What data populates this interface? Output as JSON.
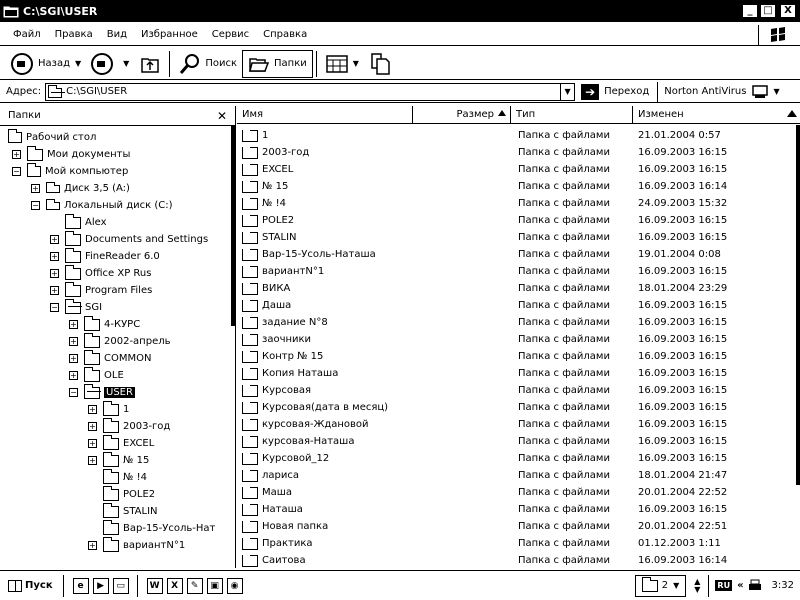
{
  "window": {
    "title": "C:\\SGI\\USER",
    "min_glyph": "_",
    "max_glyph": "□",
    "close_glyph": "X"
  },
  "menu": [
    "Файл",
    "Правка",
    "Вид",
    "Избранное",
    "Сервис",
    "Справка"
  ],
  "toolbar": {
    "back_label": "Назад",
    "search_label": "Поиск",
    "folders_label": "Папки"
  },
  "address": {
    "label": "Адрес:",
    "value": "C:\\SGI\\USER",
    "go_label": "Переход",
    "norton_label": "Norton AntiVirus"
  },
  "folders_panel": {
    "title": "Папки",
    "close_glyph": "✕",
    "tree": [
      {
        "label": "Рабочий стол",
        "level": 0,
        "expander": "none",
        "icon": "desktop"
      },
      {
        "label": "Мои документы",
        "level": 1,
        "expander": "+",
        "icon": "folder"
      },
      {
        "label": "Мой компьютер",
        "level": 1,
        "expander": "−",
        "icon": "computer"
      },
      {
        "label": "Диск 3,5 (A:)",
        "level": 2,
        "expander": "+",
        "icon": "floppy"
      },
      {
        "label": "Локальный диск (C:)",
        "level": 2,
        "expander": "−",
        "icon": "drive"
      },
      {
        "label": "Alex",
        "level": 3,
        "expander": "none",
        "icon": "folder"
      },
      {
        "label": "Documents and Settings",
        "level": 3,
        "expander": "+",
        "icon": "folder"
      },
      {
        "label": "FineReader 6.0",
        "level": 3,
        "expander": "+",
        "icon": "folder"
      },
      {
        "label": "Office XP Rus",
        "level": 3,
        "expander": "+",
        "icon": "folder"
      },
      {
        "label": "Program Files",
        "level": 3,
        "expander": "+",
        "icon": "folder"
      },
      {
        "label": "SGI",
        "level": 3,
        "expander": "−",
        "icon": "folder-open"
      },
      {
        "label": "4-КУРС",
        "level": 4,
        "expander": "+",
        "icon": "folder"
      },
      {
        "label": "2002-апрель",
        "level": 4,
        "expander": "+",
        "icon": "folder"
      },
      {
        "label": "COMMON",
        "level": 4,
        "expander": "+",
        "icon": "folder"
      },
      {
        "label": "OLE",
        "level": 4,
        "expander": "+",
        "icon": "folder"
      },
      {
        "label": "USER",
        "level": 4,
        "expander": "−",
        "icon": "folder-open",
        "selected": true
      },
      {
        "label": "1",
        "level": 5,
        "expander": "+",
        "icon": "folder"
      },
      {
        "label": "2003-год",
        "level": 5,
        "expander": "+",
        "icon": "folder"
      },
      {
        "label": "EXCEL",
        "level": 5,
        "expander": "+",
        "icon": "folder"
      },
      {
        "label": "№ 15",
        "level": 5,
        "expander": "+",
        "icon": "folder"
      },
      {
        "label": "№ !4",
        "level": 5,
        "expander": "none",
        "icon": "folder"
      },
      {
        "label": "POLE2",
        "level": 5,
        "expander": "none",
        "icon": "folder"
      },
      {
        "label": "STALIN",
        "level": 5,
        "expander": "none",
        "icon": "folder"
      },
      {
        "label": "Вар-15-Усоль-Нат",
        "level": 5,
        "expander": "none",
        "icon": "folder"
      },
      {
        "label": "вариантN°1",
        "level": 5,
        "expander": "+",
        "icon": "folder"
      }
    ]
  },
  "file_list": {
    "columns": {
      "name": "Имя",
      "size": "Размер",
      "type": "Тип",
      "modified": "Изменен"
    },
    "rows": [
      {
        "name": "1",
        "type": "Папка с файлами",
        "modified": "21.01.2004 0:57"
      },
      {
        "name": "2003-год",
        "type": "Папка с файлами",
        "modified": "16.09.2003 16:15"
      },
      {
        "name": "EXCEL",
        "type": "Папка с файлами",
        "modified": "16.09.2003 16:15"
      },
      {
        "name": "№ 15",
        "type": "Папка с файлами",
        "modified": "16.09.2003 16:14"
      },
      {
        "name": "№ !4",
        "type": "Папка с файлами",
        "modified": "24.09.2003 15:32"
      },
      {
        "name": "POLE2",
        "type": "Папка с файлами",
        "modified": "16.09.2003 16:15"
      },
      {
        "name": "STALIN",
        "type": "Папка с файлами",
        "modified": "16.09.2003 16:15"
      },
      {
        "name": "Вар-15-Усоль-Наташа",
        "type": "Папка с файлами",
        "modified": "19.01.2004 0:08"
      },
      {
        "name": "вариантN°1",
        "type": "Папка с файлами",
        "modified": "16.09.2003 16:15"
      },
      {
        "name": "ВИКА",
        "type": "Папка с файлами",
        "modified": "18.01.2004 23:29"
      },
      {
        "name": "Даша",
        "type": "Папка с файлами",
        "modified": "16.09.2003 16:15"
      },
      {
        "name": "задание N°8",
        "type": "Папка с файлами",
        "modified": "16.09.2003 16:15"
      },
      {
        "name": "заочники",
        "type": "Папка с файлами",
        "modified": "16.09.2003 16:15"
      },
      {
        "name": "Контр № 15",
        "type": "Папка с файлами",
        "modified": "16.09.2003 16:15"
      },
      {
        "name": "Копия Наташа",
        "type": "Папка с файлами",
        "modified": "16.09.2003 16:15"
      },
      {
        "name": "Курсовая",
        "type": "Папка с файлами",
        "modified": "16.09.2003 16:15"
      },
      {
        "name": "Курсовая(дата в месяц)",
        "type": "Папка с файлами",
        "modified": "16.09.2003 16:15"
      },
      {
        "name": "курсовая-Ждановой",
        "type": "Папка с файлами",
        "modified": "16.09.2003 16:15"
      },
      {
        "name": "курсовая-Наташа",
        "type": "Папка с файлами",
        "modified": "16.09.2003 16:15"
      },
      {
        "name": "Курсовой_12",
        "type": "Папка с файлами",
        "modified": "16.09.2003 16:15"
      },
      {
        "name": "лариса",
        "type": "Папка с файлами",
        "modified": "18.01.2004 21:47"
      },
      {
        "name": "Маша",
        "type": "Папка с файлами",
        "modified": "20.01.2004 22:52"
      },
      {
        "name": "Наташа",
        "type": "Папка с файлами",
        "modified": "16.09.2003 16:15"
      },
      {
        "name": "Новая папка",
        "type": "Папка с файлами",
        "modified": "20.01.2004 22:51"
      },
      {
        "name": "Практика",
        "type": "Папка с файлами",
        "modified": "01.12.2003 1:11"
      },
      {
        "name": "Саитова",
        "type": "Папка с файлами",
        "modified": "16.09.2003 16:14"
      }
    ]
  },
  "taskbar": {
    "start_label": "Пуск",
    "task_count": "2",
    "keyboard_lang": "RU",
    "clock": "3:32",
    "chevron": "«"
  }
}
